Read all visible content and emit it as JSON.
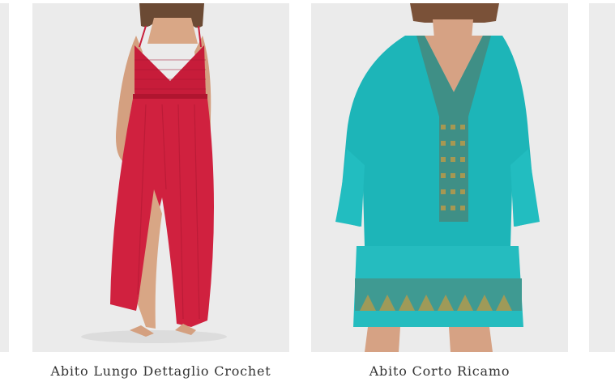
{
  "products": [
    {
      "name": "Abito Lungo Dettaglio Crochet",
      "image": "red-maxi-dress-crochet-bodice",
      "color": "#d0213f"
    },
    {
      "name": "Abito Corto Ricamo",
      "image": "turquoise-short-embroidered-dress",
      "color": "#1db5b8"
    }
  ],
  "partial_cards": {
    "left": "product-card-partial",
    "right": "product-card-partial"
  }
}
